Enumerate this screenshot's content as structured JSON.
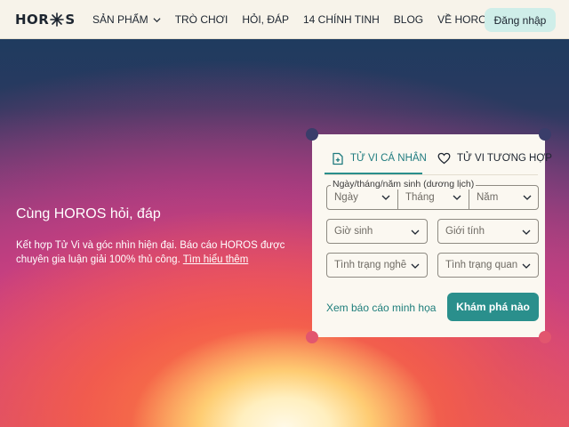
{
  "brand": {
    "logo_left": "HOR",
    "logo_right": "S"
  },
  "nav": {
    "items": [
      {
        "label": "SẢN PHẨM",
        "has_dropdown": true
      },
      {
        "label": "TRÒ CHƠI",
        "has_dropdown": false
      },
      {
        "label": "HỎI, ĐÁP",
        "has_dropdown": false
      },
      {
        "label": "14 CHÍNH TINH",
        "has_dropdown": false
      },
      {
        "label": "BLOG",
        "has_dropdown": false
      },
      {
        "label": "VỀ HOROS",
        "has_dropdown": true
      }
    ],
    "login_label": "Đăng nhập"
  },
  "hero": {
    "title": "Cùng HOROS hỏi, đáp",
    "description_line1": "Kết hợp Tử Vi và góc nhìn hiện đại. Báo cáo HOROS được",
    "description_line2": "chuyên gia luận giải 100% thủ công.",
    "learn_more": "Tìm hiểu thêm"
  },
  "form": {
    "tabs": [
      {
        "label": "TỬ VI CÁ NHÂN",
        "icon": "add-document-icon",
        "active": true
      },
      {
        "label": "TỬ VI TƯƠNG HỢP",
        "icon": "heart-icon",
        "active": false
      }
    ],
    "dob_legend": "Ngày/tháng/năm sinh (dương lịch)",
    "day_placeholder": "Ngày",
    "month_placeholder": "Tháng",
    "year_placeholder": "Năm",
    "birth_hour_placeholder": "Giờ sinh",
    "gender_placeholder": "Giới tính",
    "occupation_placeholder": "Tình trạng nghề nghiệp",
    "relationship_placeholder": "Tình trạng quan hệ",
    "sample_report_link": "Xem báo cáo minh họa",
    "submit_label": "Khám phá nào"
  },
  "colors": {
    "accent": "#2a8f8c",
    "header_bg": "#f7f3ea",
    "login_bg": "#cfeee9",
    "card_bg": "#fbf8f1"
  }
}
